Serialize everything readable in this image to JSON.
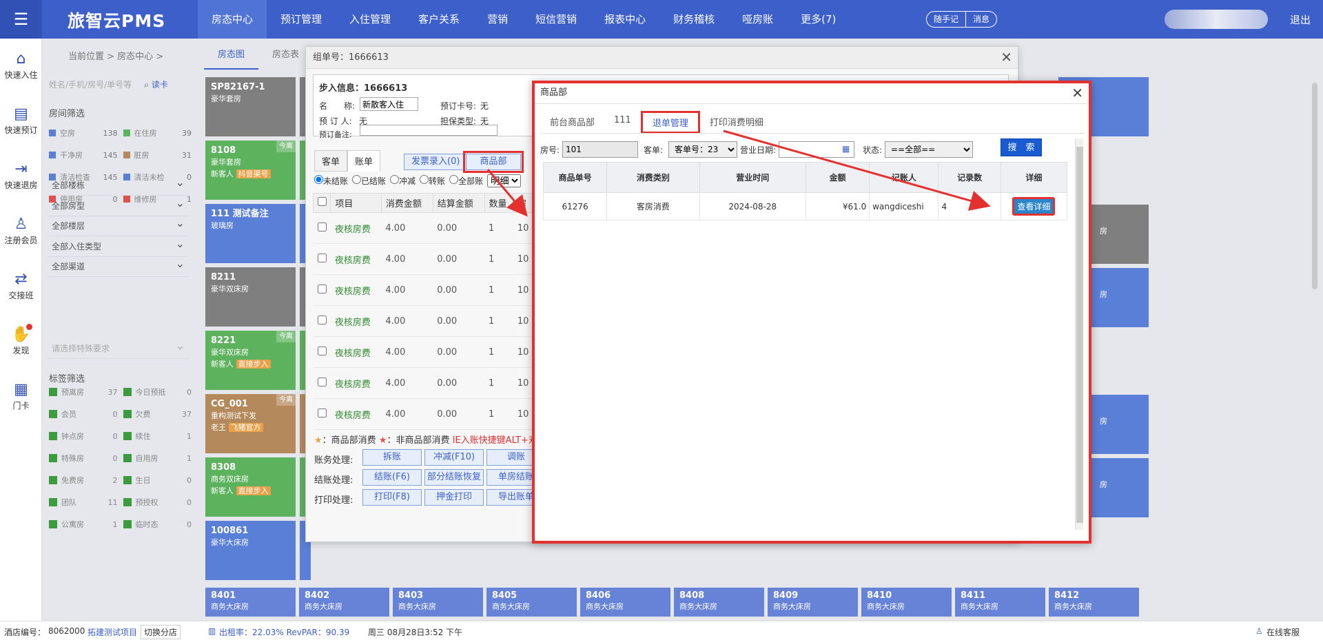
{
  "app": {
    "logo": "旅智云PMS",
    "logout": "退出",
    "menu_icon": "menu-icon"
  },
  "nav": [
    "房态中心",
    "预订管理",
    "入住管理",
    "客户关系",
    "营销",
    "短信营销",
    "报表中心",
    "财务稽核",
    "哑房账",
    "更多(7)"
  ],
  "nav_pills": [
    "随手记",
    "消息"
  ],
  "sidebar": [
    {
      "label": "快速入住",
      "icon": "home-icon"
    },
    {
      "label": "快速预订",
      "icon": "document-icon"
    },
    {
      "label": "快速退房",
      "icon": "exit-icon"
    },
    {
      "label": "注册会员",
      "icon": "add-user-icon"
    },
    {
      "label": "交接班",
      "icon": "handover-icon"
    },
    {
      "label": "发现",
      "icon": "discover-icon"
    },
    {
      "label": "门卡",
      "icon": "card-icon"
    }
  ],
  "breadcrumb": "当前位置 > 房态中心 >",
  "top_tabs": [
    "房态图",
    "房态表"
  ],
  "filter": {
    "search_placeholder": "姓名/手机/房号/单号等",
    "read_card": "读卡",
    "room_filter_title": "房间筛选",
    "room_status": [
      {
        "label": "空房",
        "count": "138",
        "color": "#5a7fd6"
      },
      {
        "label": "在住房",
        "count": "39",
        "color": "#5db25d"
      },
      {
        "label": "干净房",
        "count": "145",
        "color": "#5a7fd6"
      },
      {
        "label": "脏房",
        "count": "31",
        "color": "#b48a5c"
      },
      {
        "label": "清洁检查",
        "count": "145",
        "color": "#5a7fd6"
      },
      {
        "label": "清洁未检",
        "count": "0",
        "color": "#5a7fd6"
      },
      {
        "label": "停用房",
        "count": "0",
        "color": "#e05050"
      },
      {
        "label": "维修房",
        "count": "1",
        "color": "#e05050"
      }
    ],
    "dropdowns": [
      "全部楼栋",
      "全部房型",
      "全部楼层",
      "全部入住类型",
      "全部渠道"
    ],
    "feature_placeholder": "请选择特殊要求",
    "tag_filter_title": "标签筛选",
    "tags": [
      {
        "label": "预离房",
        "count": "37"
      },
      {
        "label": "今日预抵",
        "count": "0"
      },
      {
        "label": "会员",
        "count": "0"
      },
      {
        "label": "欠费",
        "count": "37"
      },
      {
        "label": "钟点房",
        "count": "0"
      },
      {
        "label": "续住",
        "count": "1"
      },
      {
        "label": "特殊房",
        "count": "0"
      },
      {
        "label": "自用房",
        "count": "1"
      },
      {
        "label": "免费房",
        "count": "2"
      },
      {
        "label": "生日",
        "count": "0"
      },
      {
        "label": "团队",
        "count": "11"
      },
      {
        "label": "预授权",
        "count": "0"
      },
      {
        "label": "公寓房",
        "count": "1"
      },
      {
        "label": "临时态",
        "count": "0"
      }
    ]
  },
  "rooms": [
    {
      "no": "SP82167-1",
      "type": "豪华套房",
      "cls": "g"
    },
    {
      "no": "8108",
      "type": "豪华套房",
      "guest": "新客人",
      "tag": "抖音渠号",
      "badge": "今离",
      "cls": "gr"
    },
    {
      "no": "111 测试备注",
      "type": "玻璃房",
      "cls": "bl"
    },
    {
      "no": "8211",
      "type": "豪华双床房",
      "cls": "g"
    },
    {
      "no": "8221",
      "type": "豪华双床房",
      "guest": "新客人",
      "tag": "直接步入",
      "badge": "今离",
      "cls": "gr"
    },
    {
      "no": "CG_001",
      "type": "重构测试下发",
      "guest": "老王",
      "tag": "飞猪官方",
      "badge": "今离",
      "cls": "br"
    },
    {
      "no": "8308",
      "type": "商务双床房",
      "guest": "新客人",
      "tag": "直接步入",
      "cls": "gr"
    },
    {
      "no": "100861",
      "type": "豪华大床房",
      "cls": "bl"
    }
  ],
  "bottom_rooms": [
    {
      "no": "8401",
      "type": "商务大床房"
    },
    {
      "no": "8402",
      "type": "商务大床房"
    },
    {
      "no": "8403",
      "type": "商务大床房"
    },
    {
      "no": "8405",
      "type": "商务大床房"
    },
    {
      "no": "8406",
      "type": "商务大床房"
    },
    {
      "no": "8408",
      "type": "商务大床房"
    },
    {
      "no": "8409",
      "type": "商务大床房"
    },
    {
      "no": "8410",
      "type": "商务大床房"
    },
    {
      "no": "8411",
      "type": "商务大床房"
    },
    {
      "no": "8412",
      "type": "商务大床房"
    }
  ],
  "side_room_labels": [
    "房",
    "房",
    "房",
    "房",
    "房"
  ],
  "order_modal": {
    "title": "组单号：1666613",
    "info_title": "步入信息：1666613",
    "name_label": "名　　称:",
    "name_value": "新散客入住",
    "booker_label": "预 订 人:",
    "booker_value": "无",
    "remark_label": "预订备注:",
    "card_label": "预订卡号:",
    "card_value": "无",
    "guarantee_label": "担保类型:",
    "guarantee_value": "无",
    "tabs": [
      "客单",
      "账单"
    ],
    "btn_invoice": "发票录入(0)",
    "btn_goods": "商品部",
    "radios": [
      "未结账",
      "已结账",
      "冲减",
      "转账",
      "全部账"
    ],
    "detail_select": "明细",
    "table_headers": [
      "项目",
      "消费金额",
      "结算金额",
      "数量",
      "房"
    ],
    "rows": [
      {
        "item": "夜核房费",
        "amount": "4.00",
        "settle": "0.00",
        "qty": "1",
        "room": "10"
      },
      {
        "item": "夜核房费",
        "amount": "4.00",
        "settle": "0.00",
        "qty": "1",
        "room": "10"
      },
      {
        "item": "夜核房费",
        "amount": "4.00",
        "settle": "0.00",
        "qty": "1",
        "room": "10"
      },
      {
        "item": "夜核房费",
        "amount": "4.00",
        "settle": "0.00",
        "qty": "1",
        "room": "10"
      },
      {
        "item": "夜核房费",
        "amount": "4.00",
        "settle": "0.00",
        "qty": "1",
        "room": "10"
      },
      {
        "item": "夜核房费",
        "amount": "4.00",
        "settle": "0.00",
        "qty": "1",
        "room": "10"
      },
      {
        "item": "夜核房费",
        "amount": "4.00",
        "settle": "0.00",
        "qty": "1",
        "room": "10"
      }
    ],
    "note_a": "：商品部消费",
    "note_b": "：非商品部消费",
    "note_red": "IE入账快捷键ALT+对",
    "acc_label": "账务处理:",
    "acc_btns": [
      "拆账",
      "冲减(F10)",
      "调账"
    ],
    "settle_label": "结账处理:",
    "settle_btns": [
      "结账(F6)",
      "部分结账恢复",
      "单房结账"
    ],
    "print_label": "打印处理:",
    "print_btns": [
      "打印(F8)",
      "押金打印",
      "导出账单"
    ]
  },
  "goods_modal": {
    "title": "商品部",
    "tabs": [
      "前台商品部",
      "111",
      "退单管理",
      "打印消费明细"
    ],
    "room_label": "房号:",
    "room_value": "101",
    "order_label": "客单:",
    "order_value": "客单号：23",
    "date_label": "营业日期:",
    "date_value": "",
    "status_label": "状态:",
    "status_value": "==全部==",
    "search_btn": "搜　索",
    "headers": [
      "商品单号",
      "消费类别",
      "营业时间",
      "金额",
      "记账人",
      "记录数",
      "详细"
    ],
    "rows": [
      {
        "no": "61276",
        "category": "客房消费",
        "date": "2024-08-28",
        "amount": "¥61.0",
        "operator": "wangdiceshi",
        "count": "4",
        "detail": "查看详细"
      }
    ]
  },
  "status_bar": {
    "hotel_label": "酒店编号：",
    "hotel_no": "8062000",
    "project": "拓建测试项目",
    "switch": "切换分店",
    "occupancy": "出租率：22.03% RevPAR：90.39",
    "datetime": "周三 08月28日3:52 下午",
    "service": "在线客服"
  },
  "colors": {
    "brand": "#3c5fc9",
    "highlight": "#e53030",
    "search_button": "#1a5bd1"
  }
}
